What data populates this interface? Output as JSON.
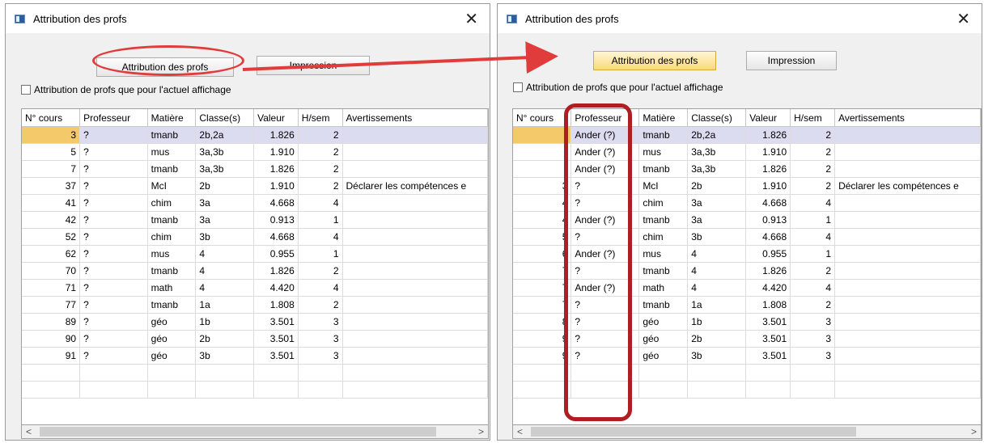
{
  "left": {
    "title": "Attribution des profs",
    "btn_attrib": "Attribution des profs",
    "btn_print": "Impression",
    "checkbox_label": "Attribution de profs que pour l'actuel affichage",
    "columns": [
      "N° cours",
      "Professeur",
      "Matière",
      "Classe(s)",
      "Valeur",
      "H/sem",
      "Avertissements"
    ],
    "rows": [
      [
        "3",
        "?",
        "tmanb",
        "2b,2a",
        "1.826",
        "2",
        ""
      ],
      [
        "5",
        "?",
        "mus",
        "3a,3b",
        "1.910",
        "2",
        ""
      ],
      [
        "7",
        "?",
        "tmanb",
        "3a,3b",
        "1.826",
        "2",
        ""
      ],
      [
        "37",
        "?",
        "McI",
        "2b",
        "1.910",
        "2",
        "Déclarer les compétences e"
      ],
      [
        "41",
        "?",
        "chim",
        "3a",
        "4.668",
        "4",
        ""
      ],
      [
        "42",
        "?",
        "tmanb",
        "3a",
        "0.913",
        "1",
        ""
      ],
      [
        "52",
        "?",
        "chim",
        "3b",
        "4.668",
        "4",
        ""
      ],
      [
        "62",
        "?",
        "mus",
        "4",
        "0.955",
        "1",
        ""
      ],
      [
        "70",
        "?",
        "tmanb",
        "4",
        "1.826",
        "2",
        ""
      ],
      [
        "71",
        "?",
        "math",
        "4",
        "4.420",
        "4",
        ""
      ],
      [
        "77",
        "?",
        "tmanb",
        "1a",
        "1.808",
        "2",
        ""
      ],
      [
        "89",
        "?",
        "géo",
        "1b",
        "3.501",
        "3",
        ""
      ],
      [
        "90",
        "?",
        "géo",
        "2b",
        "3.501",
        "3",
        ""
      ],
      [
        "91",
        "?",
        "géo",
        "3b",
        "3.501",
        "3",
        ""
      ]
    ]
  },
  "right": {
    "title": "Attribution des profs",
    "btn_attrib": "Attribution des profs",
    "btn_print": "Impression",
    "checkbox_label": "Attribution de profs que pour l'actuel affichage",
    "columns": [
      "N° cours",
      "Professeur",
      "Matière",
      "Classe(s)",
      "Valeur",
      "H/sem",
      "Avertissements"
    ],
    "rows": [
      [
        "",
        "Ander (?)",
        "tmanb",
        "2b,2a",
        "1.826",
        "2",
        ""
      ],
      [
        "",
        "Ander (?)",
        "mus",
        "3a,3b",
        "1.910",
        "2",
        ""
      ],
      [
        "",
        "Ander (?)",
        "tmanb",
        "3a,3b",
        "1.826",
        "2",
        ""
      ],
      [
        "3",
        "?",
        "McI",
        "2b",
        "1.910",
        "2",
        "Déclarer les compétences e"
      ],
      [
        "4",
        "?",
        "chim",
        "3a",
        "4.668",
        "4",
        ""
      ],
      [
        "4",
        "Ander (?)",
        "tmanb",
        "3a",
        "0.913",
        "1",
        ""
      ],
      [
        "5",
        "?",
        "chim",
        "3b",
        "4.668",
        "4",
        ""
      ],
      [
        "6",
        "Ander (?)",
        "mus",
        "4",
        "0.955",
        "1",
        ""
      ],
      [
        "7",
        "?",
        "tmanb",
        "4",
        "1.826",
        "2",
        ""
      ],
      [
        "7",
        "Ander (?)",
        "math",
        "4",
        "4.420",
        "4",
        ""
      ],
      [
        "7",
        "?",
        "tmanb",
        "1a",
        "1.808",
        "2",
        ""
      ],
      [
        "8",
        "?",
        "géo",
        "1b",
        "3.501",
        "3",
        ""
      ],
      [
        "9",
        "?",
        "géo",
        "2b",
        "3.501",
        "3",
        ""
      ],
      [
        "9",
        "?",
        "géo",
        "3b",
        "3.501",
        "3",
        ""
      ]
    ]
  },
  "colors": {
    "highlight_ellipse": "#e03c3c",
    "highlight_rect": "#b01e24",
    "selected_row": "#dcdcf0",
    "selected_cell": "#f3c96a"
  }
}
